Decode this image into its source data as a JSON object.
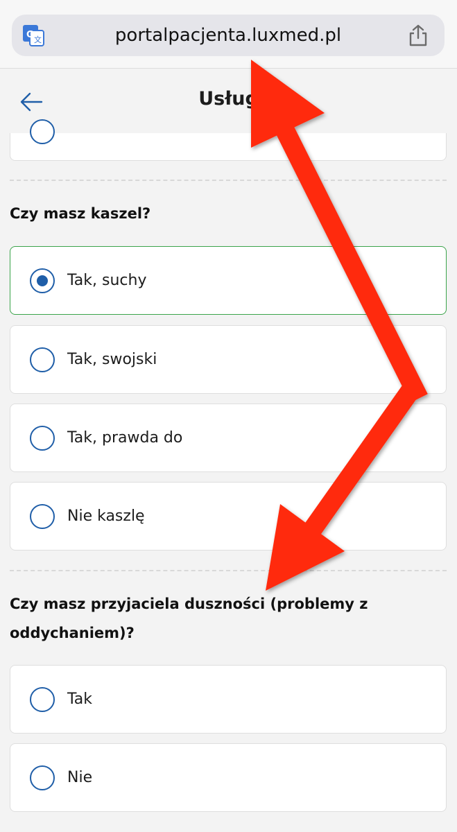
{
  "browser": {
    "url": "portalpacjenta.luxmed.pl",
    "translate_icon": "translate-icon",
    "share_icon": "share-icon"
  },
  "header": {
    "back_icon": "arrow-left-icon",
    "title": "Usług"
  },
  "questions": [
    {
      "text": "Czy masz kaszel?",
      "options": [
        {
          "label": "Tak, suchy",
          "selected": true
        },
        {
          "label": "Tak, swojski",
          "selected": false
        },
        {
          "label": "Tak, prawda do",
          "selected": false
        },
        {
          "label": "Nie kaszlę",
          "selected": false
        }
      ]
    },
    {
      "text": "Czy masz przyjaciela duszności (problemy z oddychaniem)?",
      "options": [
        {
          "label": "Tak",
          "selected": false
        },
        {
          "label": "Nie",
          "selected": false
        }
      ]
    }
  ],
  "annotation": {
    "type": "red-arrows",
    "color": "#ff2a0f"
  },
  "colors": {
    "accent": "#1f5ea8",
    "selected_border": "#3aa34a",
    "arrow": "#ff2a0f"
  }
}
